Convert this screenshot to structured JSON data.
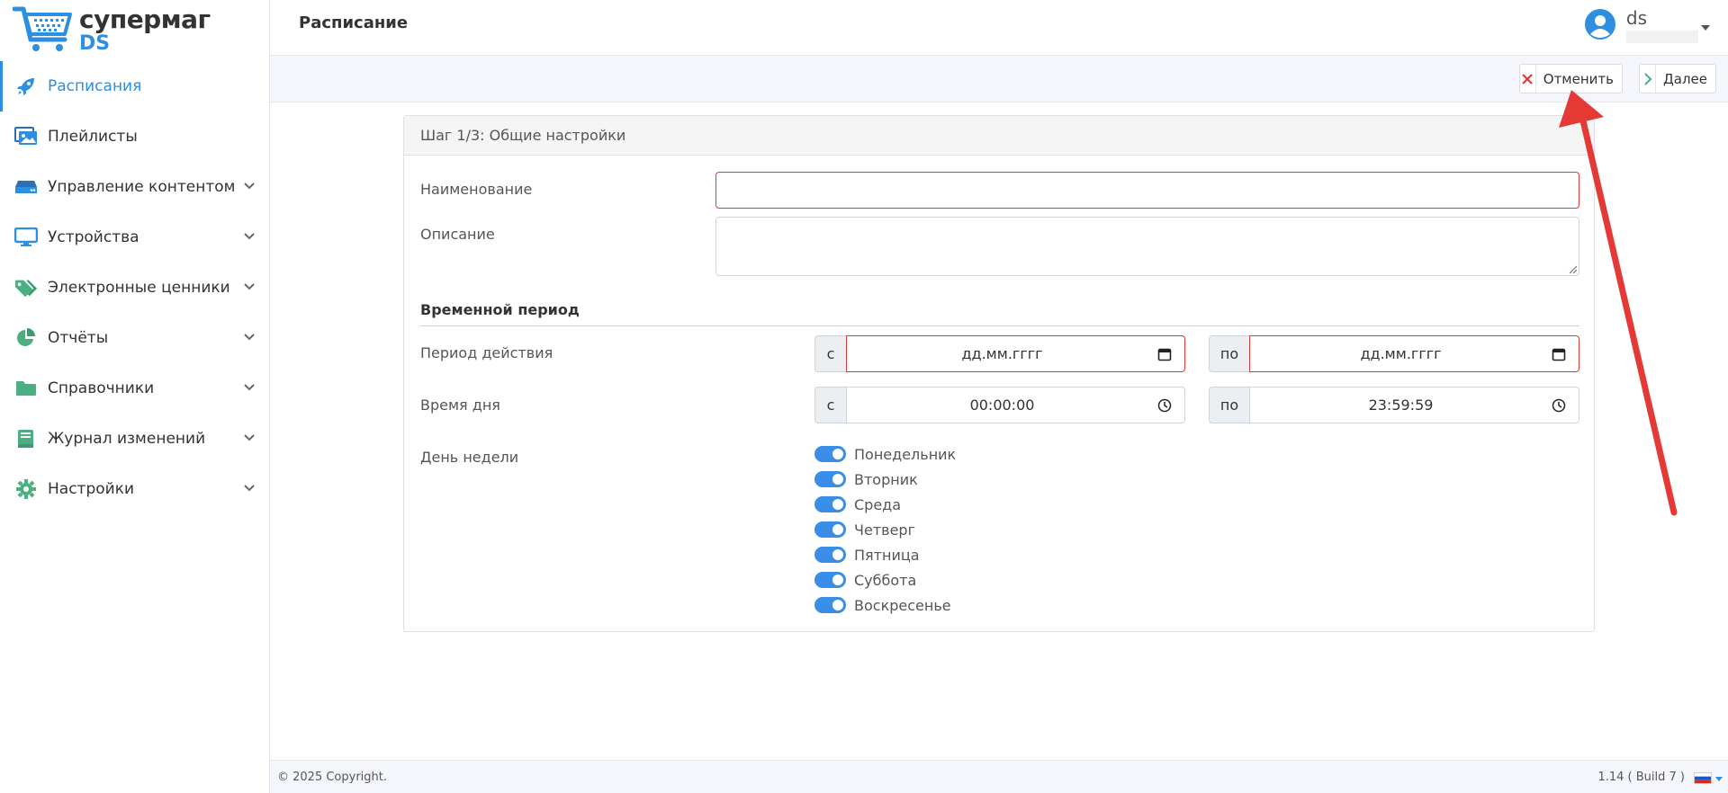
{
  "brand": {
    "name": "супермаг",
    "sub": "DS"
  },
  "sidebar": {
    "items": [
      {
        "label": "Расписания",
        "icon": "rocket-icon",
        "active": true,
        "expandable": false
      },
      {
        "label": "Плейлисты",
        "icon": "image-gallery-icon",
        "active": false,
        "expandable": false
      },
      {
        "label": "Управление контентом",
        "icon": "hard-drive-icon",
        "active": false,
        "expandable": true
      },
      {
        "label": "Устройства",
        "icon": "monitor-icon",
        "active": false,
        "expandable": true
      },
      {
        "label": "Электронные ценники",
        "icon": "tags-icon",
        "active": false,
        "expandable": true
      },
      {
        "label": "Отчёты",
        "icon": "pie-chart-icon",
        "active": false,
        "expandable": true
      },
      {
        "label": "Справочники",
        "icon": "folder-icon",
        "active": false,
        "expandable": true
      },
      {
        "label": "Журнал изменений",
        "icon": "book-icon",
        "active": false,
        "expandable": true
      },
      {
        "label": "Настройки",
        "icon": "gear-icon",
        "active": false,
        "expandable": true
      }
    ]
  },
  "header": {
    "title": "Расписание",
    "user_name": "ds"
  },
  "toolbar": {
    "cancel_label": "Отменить",
    "next_label": "Далее"
  },
  "form": {
    "step_title": "Шаг 1/3: Общие настройки",
    "name_label": "Наименование",
    "name_value": "",
    "description_label": "Описание",
    "description_value": "",
    "period_section": "Временной период",
    "validity_label": "Период действия",
    "from_prefix": "с",
    "to_prefix": "по",
    "date_from": "дд.мм.гггг",
    "date_to": "дд.мм.гггг",
    "time_label": "Время дня",
    "time_from": "00:00:00",
    "time_to": "23:59:59",
    "weekday_label": "День недели",
    "weekdays": [
      {
        "label": "Понедельник",
        "on": true
      },
      {
        "label": "Вторник",
        "on": true
      },
      {
        "label": "Среда",
        "on": true
      },
      {
        "label": "Четверг",
        "on": true
      },
      {
        "label": "Пятница",
        "on": true
      },
      {
        "label": "Суббота",
        "on": true
      },
      {
        "label": "Воскресенье",
        "on": true
      }
    ]
  },
  "footer": {
    "copyright": "© 2025 Copyright.",
    "version": "1.14 ( Build 7 )"
  },
  "colors": {
    "accent": "#2e8ee0",
    "icon_green": "#4caf82",
    "error": "#e53935",
    "annotation": "#e53935"
  }
}
